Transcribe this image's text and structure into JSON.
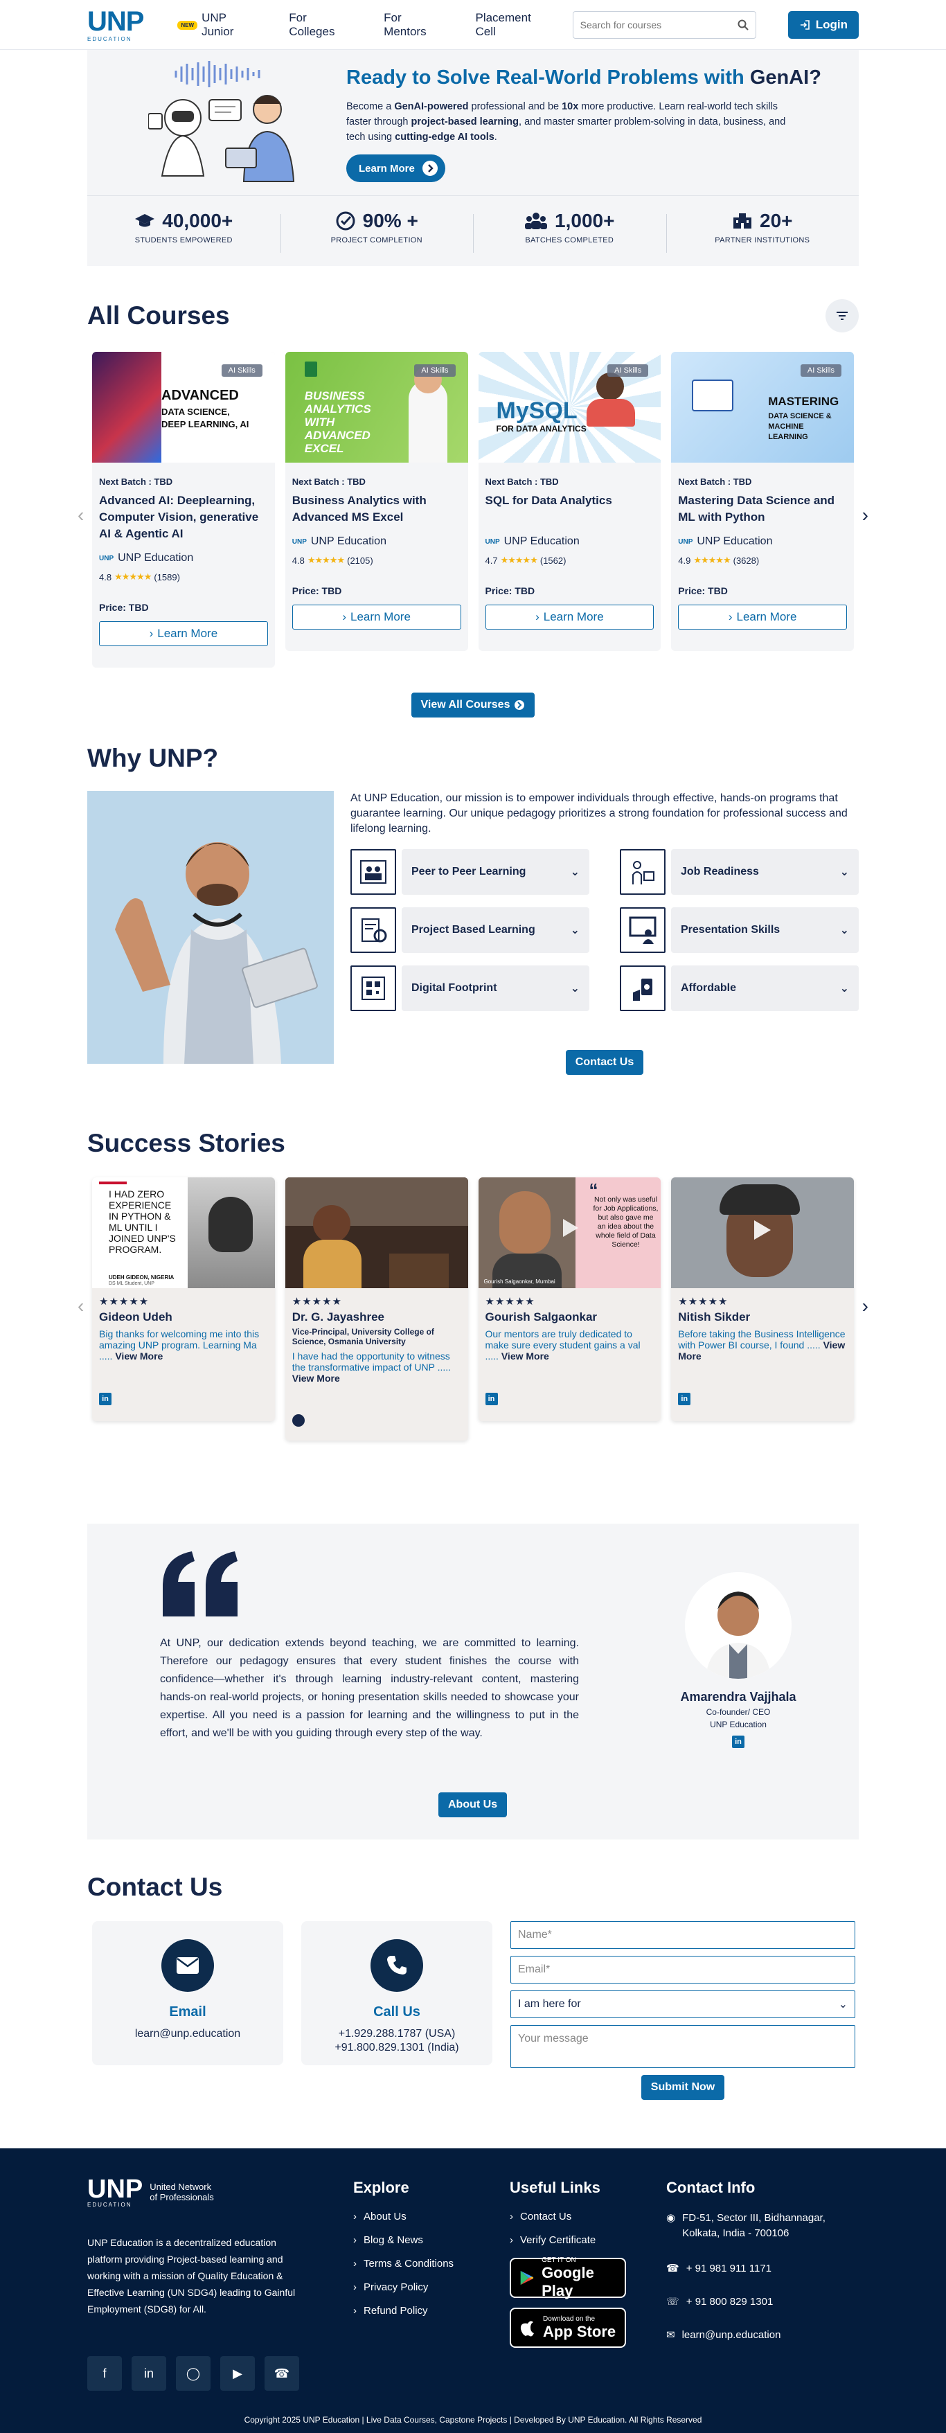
{
  "nav": {
    "logo": "UNP",
    "logo_sub": "EDUCATION",
    "new_badge": "NEW",
    "links": [
      "UNP Junior",
      "For Colleges",
      "For Mentors",
      "Placement Cell"
    ],
    "search_placeholder": "Search for courses",
    "login": "Login"
  },
  "hero": {
    "title_a": "Ready to Solve Real-World Problems with ",
    "title_b": "GenAI?",
    "desc_1": "Become a ",
    "desc_b1": "GenAI-powered",
    "desc_2": " professional and be ",
    "desc_b2": "10x",
    "desc_3": " more productive. Learn real-world tech skills faster through ",
    "desc_b3": "project-based learning",
    "desc_4": ", and master smarter problem-solving in data, business, and tech using ",
    "desc_b4": "cutting-edge AI tools",
    "desc_5": ".",
    "button": "Learn More",
    "stats": [
      {
        "num": "40,000+",
        "label": "STUDENTS EMPOWERED"
      },
      {
        "num": "90% +",
        "label": "PROJECT COMPLETION"
      },
      {
        "num": "1,000+",
        "label": "BATCHES COMPLETED"
      },
      {
        "num": "20+",
        "label": "PARTNER INSTITUTIONS"
      }
    ]
  },
  "courses": {
    "title": "All Courses",
    "items": [
      {
        "tag": "AI Skills",
        "thumb_title": "ADVANCED",
        "thumb_sub": "DATA SCIENCE, DEEP LEARNING, AI",
        "batch": "Next Batch : TBD",
        "title": "Advanced AI: Deeplearning, Computer Vision, generative AI & Agentic AI",
        "org": "UNP Education",
        "rating": "4.8",
        "count": "(1589)",
        "price": "Price: TBD",
        "cta": "Learn More"
      },
      {
        "tag": "AI Skills",
        "thumb_title": "BUSINESS ANALYTICS WITH ADVANCED EXCEL",
        "thumb_sub": "",
        "batch": "Next Batch : TBD",
        "title": "Business Analytics with Advanced MS Excel",
        "org": "UNP Education",
        "rating": "4.8",
        "count": "(2105)",
        "price": "Price: TBD",
        "cta": "Learn More"
      },
      {
        "tag": "AI Skills",
        "thumb_title": "MySQL",
        "thumb_sub": "FOR DATA ANALYTICS",
        "batch": "Next Batch : TBD",
        "title": "SQL for Data Analytics",
        "org": "UNP Education",
        "rating": "4.7",
        "count": "(1562)",
        "price": "Price: TBD",
        "cta": "Learn More"
      },
      {
        "tag": "AI Skills",
        "thumb_title": "MASTERING",
        "thumb_sub": "DATA SCIENCE & MACHINE LEARNING",
        "batch": "Next Batch : TBD",
        "title": "Mastering Data Science and ML with Python",
        "org": "UNP Education",
        "rating": "4.9",
        "count": "(3628)",
        "price": "Price: TBD",
        "cta": "Learn More"
      }
    ],
    "view_all": "View All Courses"
  },
  "why": {
    "title": "Why UNP?",
    "desc": "At UNP Education, our mission is to empower individuals through effective, hands-on programs that guarantee learning. Our unique pedagogy prioritizes a strong foundation for professional success and lifelong learning.",
    "features": [
      "Peer to Peer Learning",
      "Job Readiness",
      "Project Based Learning",
      "Presentation Skills",
      "Digital Footprint",
      "Affordable"
    ],
    "contact": "Contact Us"
  },
  "stories": {
    "title": "Success Stories",
    "thumb_quote": "I HAD ZERO EXPERIENCE IN PYTHON & ML UNTIL I JOINED UNP'S PROGRAM.",
    "thumb_name": "UDEH GIDEON, NIGERIA",
    "thumb_role": "DS ML Student, UNP",
    "thumb_bubble": "Not only was useful for Job Applications, but also gave me an idea about the whole field of Data Science!",
    "thumb_caption": "Gourish Salgaonkar, Mumbai",
    "items": [
      {
        "name": "Gideon Udeh",
        "role": "",
        "text": "Big thanks for welcoming me into this amazing UNP program. Learning Ma ..... ",
        "more": "View More"
      },
      {
        "name": "Dr. G. Jayashree",
        "role": "Vice-Principal, University College of Science, Osmania University",
        "text": "I have had the opportunity to witness the transformative impact of UNP ..... ",
        "more": "View More"
      },
      {
        "name": "Gourish Salgaonkar",
        "role": "",
        "text": "Our mentors are truly dedicated to make sure every student gains a val ..... ",
        "more": "View More"
      },
      {
        "name": "Nitish Sikder",
        "role": "",
        "text": "Before taking the Business Intelligence with Power BI course, I found ..... ",
        "more": "View More"
      }
    ]
  },
  "quote": {
    "text": "At UNP, our dedication extends beyond teaching, we are committed to learning. Therefore our pedagogy ensures that every student finishes the course with confidence—whether it's through learning industry-relevant content, mastering hands-on real-world projects, or honing presentation skills needed to showcase your expertise. All you need is a passion for learning and the willingness to put in the effort, and we'll be with you guiding through every step of the way.",
    "name": "Amarendra Vajjhala",
    "role1": "Co-founder/ CEO",
    "role2": "UNP Education",
    "about": "About Us"
  },
  "contact": {
    "title": "Contact Us",
    "email_title": "Email",
    "email": "learn@unp.education",
    "call_title": "Call Us",
    "phone1": "+1.929.288.1787 (USA)",
    "phone2": "+91.800.829.1301 (India)",
    "name_ph": "Name*",
    "email_ph": "Email*",
    "select": "I am here for",
    "msg_ph": "Your message",
    "submit": "Submit Now"
  },
  "footer": {
    "brand_1": "United Network",
    "brand_2": "of Professionals",
    "desc": "UNP Education is a decentralized education platform providing Project-based learning and working with a mission of Quality Education & Effective Learning (UN SDG4) leading to Gainful Employment (SDG8) for All.",
    "explore": "Explore",
    "explore_links": [
      "About Us",
      "Blog & News",
      "Terms & Conditions",
      "Privacy Policy",
      "Refund Policy"
    ],
    "useful": "Useful Links",
    "useful_links": [
      "Contact Us",
      "Verify Certificate"
    ],
    "gp_small": "GET IT ON",
    "gp_big": "Google Play",
    "as_small": "Download on the",
    "as_big": "App Store",
    "contact_info": "Contact Info",
    "address": "FD-51, Sector III, Bidhannagar, Kolkata, India - 700106",
    "phone1": "+ 91 981 911 1171",
    "phone2": "+ 91 800 829 1301",
    "email": "learn@unp.education",
    "copyright": "Copyright 2025 UNP Education | Live Data Courses, Capstone Projects | Developed By UNP Education. All Rights Reserved"
  },
  "colors": {
    "primary": "#0b6aa8",
    "navy": "#17274a",
    "footer": "#041c3c"
  }
}
